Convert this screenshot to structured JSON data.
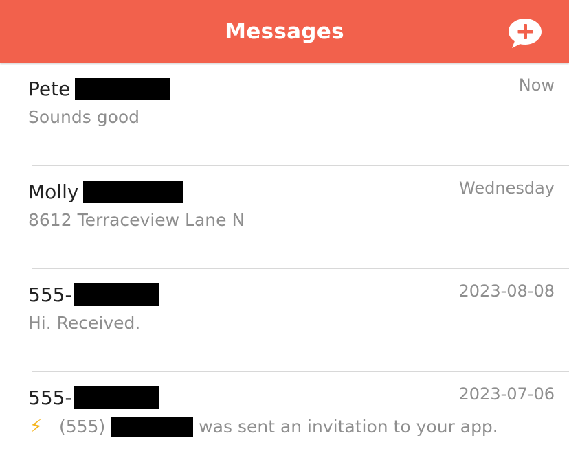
{
  "header": {
    "title": "Messages",
    "compose_icon": "chat-bubble-plus-icon",
    "accent_color": "#f2614c"
  },
  "conversations": [
    {
      "name": "Pete",
      "time": "Now",
      "preview": "Sounds good"
    },
    {
      "name": "Molly",
      "time": "Wednesday",
      "preview": "8612 Terraceview Lane N"
    },
    {
      "name": "555-",
      "time": "2023-08-08",
      "preview": "Hi. Received."
    },
    {
      "name": "555-",
      "time": "2023-07-06",
      "preview_icon": "lightning-bolt-icon",
      "preview_prefix": "(555)",
      "preview_suffix": "was sent an invitation to your app."
    }
  ]
}
